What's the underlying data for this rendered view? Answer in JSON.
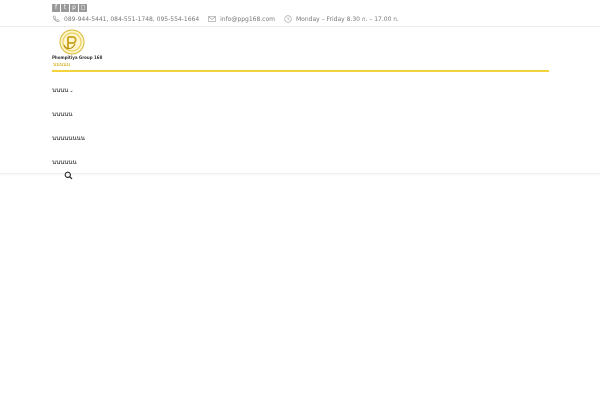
{
  "topbar": {
    "social": [
      {
        "name": "facebook-icon",
        "glyph": "f"
      },
      {
        "name": "twitter-icon",
        "glyph": "t"
      },
      {
        "name": "pinterest-icon",
        "glyph": "p"
      },
      {
        "name": "instagram-icon",
        "glyph": "◻"
      }
    ],
    "phones": "089-944-5441, 084-551-1748, 095-554-1664",
    "email": "info@ppg168.com",
    "hours": "Monday – Friday 8.30 ก. – 17.00 ก."
  },
  "logo": {
    "company": "Phompitiya Group 168",
    "tagline": "นนนนน",
    "accent": "#d9b82f"
  },
  "menu": {
    "items": [
      {
        "label": "นนนน",
        "has_dropdown": true,
        "chevron": "⌄"
      },
      {
        "label": "นนนนน"
      },
      {
        "label": "นนนนนนนน"
      },
      {
        "label": "นนนนนน"
      }
    ]
  },
  "colors": {
    "accent_line": "#f2d33c",
    "muted_text": "#777777"
  }
}
